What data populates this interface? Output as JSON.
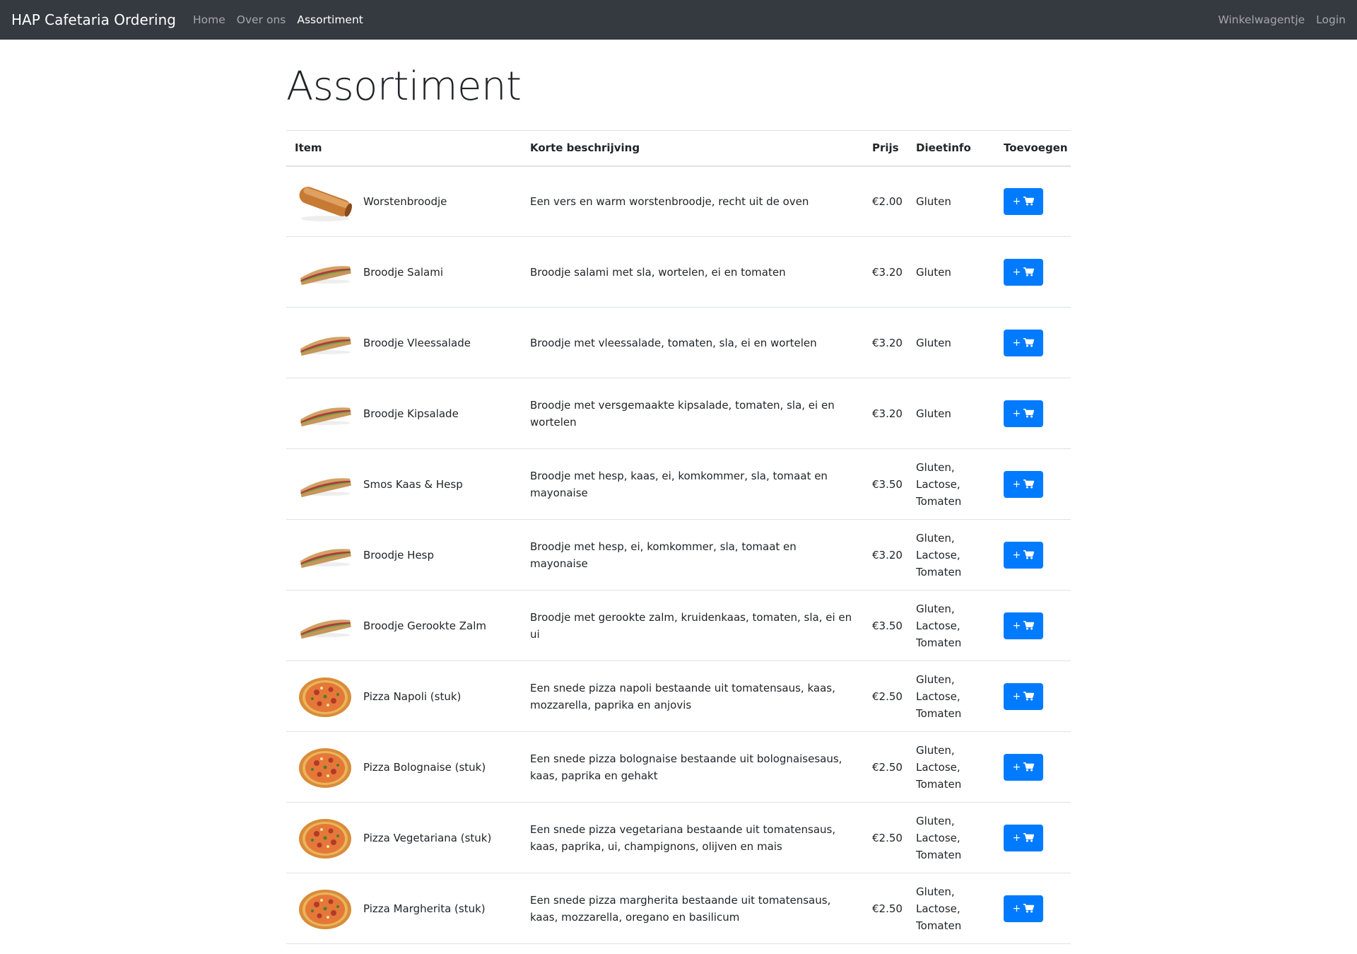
{
  "navbar": {
    "brand": "HAP Cafetaria Ordering",
    "links": [
      {
        "label": "Home",
        "active": false
      },
      {
        "label": "Over ons",
        "active": false
      },
      {
        "label": "Assortiment",
        "active": true
      }
    ],
    "right_links": [
      {
        "label": "Winkelwagentje"
      },
      {
        "label": "Login"
      }
    ]
  },
  "page": {
    "title": "Assortiment"
  },
  "table": {
    "headers": {
      "item": "Item",
      "description": "Korte beschrijving",
      "price": "Prijs",
      "diet": "Dieetinfo",
      "add": "Toevoegen"
    },
    "add_button_plus": "+",
    "add_button_icon": "shopping-cart-icon",
    "rows": [
      {
        "name": "Worstenbroodje",
        "image": "sausage-roll",
        "description": "Een vers en warm worstenbroodje, recht uit de oven",
        "price": "€2.00",
        "diet": "Gluten"
      },
      {
        "name": "Broodje Salami",
        "image": "sandwich",
        "description": "Broodje salami met sla, wortelen, ei en tomaten",
        "price": "€3.20",
        "diet": "Gluten"
      },
      {
        "name": "Broodje Vleessalade",
        "image": "sandwich",
        "description": "Broodje met vleessalade, tomaten, sla, ei en wortelen",
        "price": "€3.20",
        "diet": "Gluten"
      },
      {
        "name": "Broodje Kipsalade",
        "image": "sandwich",
        "description": "Broodje met versgemaakte kipsalade, tomaten, sla, ei en wortelen",
        "price": "€3.20",
        "diet": "Gluten"
      },
      {
        "name": "Smos Kaas & Hesp",
        "image": "sandwich",
        "description": "Broodje met hesp, kaas, ei, komkommer, sla, tomaat en mayonaise",
        "price": "€3.50",
        "diet": "Gluten, Lactose, Tomaten"
      },
      {
        "name": "Broodje Hesp",
        "image": "sandwich",
        "description": "Broodje met hesp, ei, komkommer, sla, tomaat en mayonaise",
        "price": "€3.20",
        "diet": "Gluten, Lactose, Tomaten"
      },
      {
        "name": "Broodje Gerookte Zalm",
        "image": "sandwich",
        "description": "Broodje met gerookte zalm, kruidenkaas, tomaten, sla, ei en ui",
        "price": "€3.50",
        "diet": "Gluten, Lactose, Tomaten"
      },
      {
        "name": "Pizza Napoli (stuk)",
        "image": "pizza",
        "description": "Een snede pizza napoli bestaande uit tomatensaus, kaas, mozzarella, paprika en anjovis",
        "price": "€2.50",
        "diet": "Gluten, Lactose, Tomaten"
      },
      {
        "name": "Pizza Bolognaise (stuk)",
        "image": "pizza",
        "description": "Een snede pizza bolognaise bestaande uit bolognaisesaus, kaas, paprika en gehakt",
        "price": "€2.50",
        "diet": "Gluten, Lactose, Tomaten"
      },
      {
        "name": "Pizza Vegetariana (stuk)",
        "image": "pizza",
        "description": "Een snede pizza vegetariana bestaande uit tomatensaus, kaas, paprika, ui, champignons, olijven en mais",
        "price": "€2.50",
        "diet": "Gluten, Lactose, Tomaten"
      },
      {
        "name": "Pizza Margherita (stuk)",
        "image": "pizza",
        "description": "Een snede pizza margherita bestaande uit tomatensaus, kaas, mozzarella, oregano en basilicum",
        "price": "€2.50",
        "diet": "Gluten, Lactose, Tomaten"
      }
    ]
  },
  "colors": {
    "navbar_bg": "#343a40",
    "primary_button": "#007bff",
    "border": "#dee2e6",
    "text": "#212529"
  }
}
